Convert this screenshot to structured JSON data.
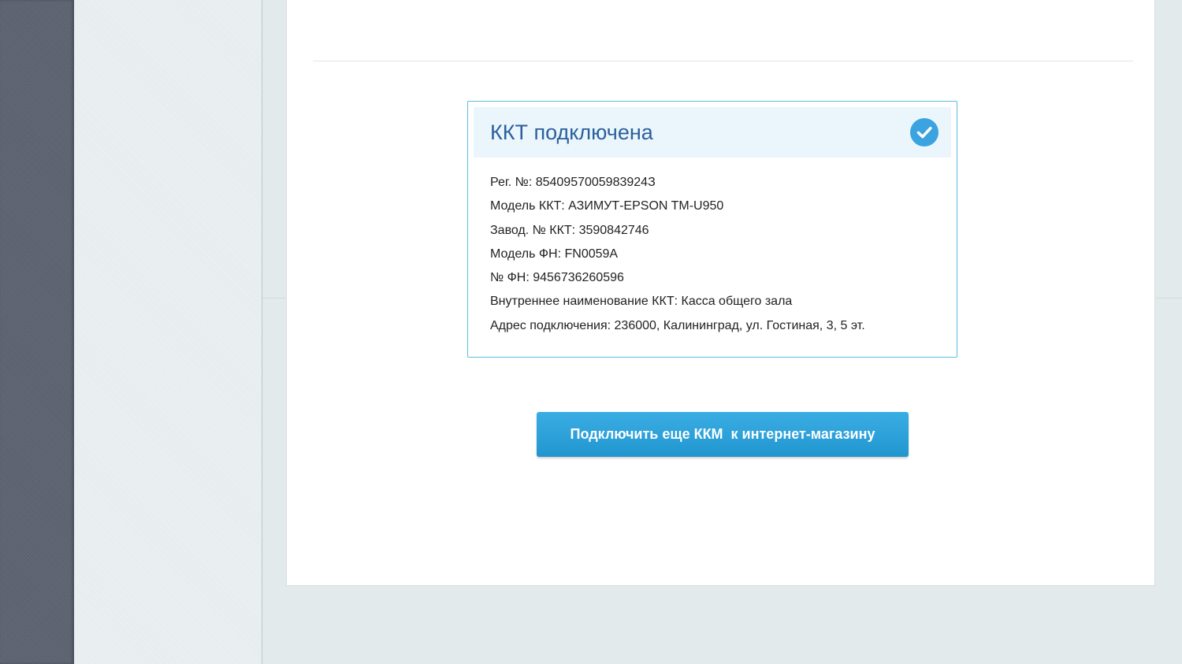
{
  "status_card": {
    "title": "ККТ подключена",
    "status_icon": "check-circle-icon",
    "details": [
      "Рег. №: 8540957005983924З",
      "Модель ККТ: АЗИМУТ-EPSON TM-U950",
      "Завод. № ККТ: 3590842746",
      "Модель ФН: FN0059A",
      "№ ФН: 9456736260596",
      "Внутреннее наименование ККТ: Касса общего зала",
      "Адрес подключения: 236000, Калининград, ул. Гостиная, 3, 5 эт."
    ]
  },
  "actions": {
    "add_kkm_label": "Подключить еще ККМ  к интернет-магазину"
  },
  "colors": {
    "accent": "#2c9fd9",
    "title_text": "#2c5f9c",
    "card_border": "#5bbde0",
    "header_bg": "#eaf6fc",
    "rail": "#5d6472"
  }
}
